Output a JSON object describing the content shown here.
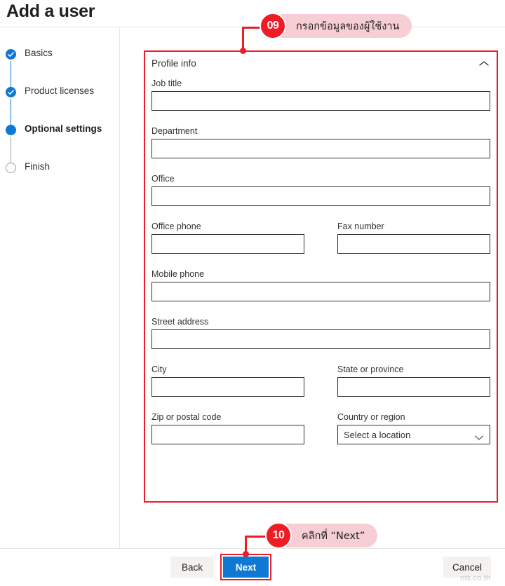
{
  "page": {
    "title": "Add a user",
    "watermark": "nts.co.th"
  },
  "sidebar": {
    "steps": [
      {
        "label": "Basics",
        "state": "done"
      },
      {
        "label": "Product licenses",
        "state": "done"
      },
      {
        "label": "Optional settings",
        "state": "current"
      },
      {
        "label": "Finish",
        "state": "todo"
      }
    ]
  },
  "panel": {
    "title": "Profile info",
    "collapse_icon": "chevron-up-icon",
    "fields": {
      "job_title": {
        "label": "Job title",
        "value": "",
        "placeholder": ""
      },
      "department": {
        "label": "Department",
        "value": "",
        "placeholder": ""
      },
      "office": {
        "label": "Office",
        "value": "",
        "placeholder": ""
      },
      "office_phone": {
        "label": "Office phone",
        "value": "",
        "placeholder": ""
      },
      "fax_number": {
        "label": "Fax number",
        "value": "",
        "placeholder": ""
      },
      "mobile_phone": {
        "label": "Mobile phone",
        "value": "",
        "placeholder": ""
      },
      "street_address": {
        "label": "Street address",
        "value": "",
        "placeholder": ""
      },
      "city": {
        "label": "City",
        "value": "",
        "placeholder": ""
      },
      "state_or_province": {
        "label": "State or province",
        "value": "",
        "placeholder": ""
      },
      "zip_or_postal_code": {
        "label": "Zip or postal code",
        "value": "",
        "placeholder": ""
      },
      "country_or_region": {
        "label": "Country or region",
        "selected": "Select a location",
        "dropdown_icon": "chevron-down-icon"
      }
    }
  },
  "footer": {
    "back_label": "Back",
    "next_label": "Next",
    "cancel_label": "Cancel"
  },
  "annotations": [
    {
      "number": "09",
      "text": "กรอกข้อมูลของผู้ใช้งาน"
    },
    {
      "number": "10",
      "text": "คลิกที่ “Next”"
    }
  ],
  "colors": {
    "accent_blue": "#0f78d4",
    "annotation_red": "#ee1c25",
    "annotation_pink": "#f7ced4",
    "button_gray": "#f3f2f1"
  }
}
